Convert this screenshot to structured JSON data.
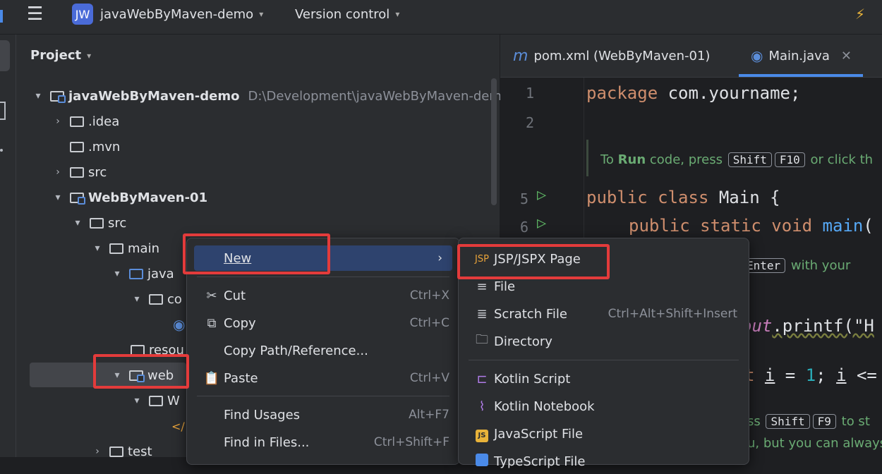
{
  "topbar": {
    "project_badge": "JW",
    "project_name": "javaWebByMaven-demo",
    "vcs": "Version control"
  },
  "project_panel": {
    "title": "Project",
    "tree": [
      {
        "label": "javaWebByMaven-demo",
        "path": "D:\\Development\\javaWebByMaven-demo"
      },
      {
        "label": ".idea"
      },
      {
        "label": ".mvn"
      },
      {
        "label": "src"
      },
      {
        "label": "WebByMaven-01"
      },
      {
        "label": "src"
      },
      {
        "label": "main"
      },
      {
        "label": "java"
      },
      {
        "label": "co"
      },
      {
        "label": "resou"
      },
      {
        "label": "web"
      },
      {
        "label": "W"
      },
      {
        "label": "test"
      }
    ]
  },
  "editor": {
    "tabs": [
      {
        "label": "pom.xml (WebByMaven-01)"
      },
      {
        "label": "Main.java"
      }
    ],
    "line_numbers": [
      "1",
      "2",
      "5",
      "6"
    ],
    "code": {
      "line1_kw": "package",
      "line1_rest": " com.yourname;",
      "line5_kw": "public class",
      "line5_rest": " Main {",
      "line6_kw": "public static void",
      "line6_fn": "main",
      "line6_rest": "(",
      "out_printf": "out",
      "printf": ".printf(\"H",
      "loop_kw": "t",
      "loop_rest": " = ",
      "loop_num": "1",
      "loop_rest2": "; ",
      "loop_i": "i",
      "loop_end": " <=",
      "loop_i1": "i"
    },
    "hints": {
      "run_prefix": "To ",
      "run_bold": "Run",
      "run_mid": " code, press ",
      "run_key1": "Shift",
      "run_key2": "F10",
      "run_suffix": " or click th",
      "enter_key_partial": "",
      "enter_key": "Enter",
      "enter_suffix": " with your",
      "debug_prefix": "ss ",
      "debug_key1": "Shift",
      "debug_key2": "F9",
      "debug_suffix": " to st",
      "last_line": "u, but you can always"
    }
  },
  "context_menu": {
    "items": [
      {
        "label": "New"
      },
      {
        "label": "Cut",
        "shortcut": "Ctrl+X"
      },
      {
        "label": "Copy",
        "shortcut": "Ctrl+C"
      },
      {
        "label": "Copy Path/Reference..."
      },
      {
        "label": "Paste",
        "shortcut": "Ctrl+V"
      },
      {
        "label": "Find Usages",
        "shortcut": "Alt+F7"
      },
      {
        "label": "Find in Files...",
        "shortcut": "Ctrl+Shift+F"
      }
    ]
  },
  "submenu": {
    "items": [
      {
        "label": "JSP/JSPX Page",
        "icon": "JSP"
      },
      {
        "label": "File"
      },
      {
        "label": "Scratch File",
        "shortcut": "Ctrl+Alt+Shift+Insert"
      },
      {
        "label": "Directory"
      },
      {
        "label": "Kotlin Script"
      },
      {
        "label": "Kotlin Notebook"
      },
      {
        "label": "JavaScript File",
        "icon": "JS"
      },
      {
        "label": "TypeScript File"
      }
    ]
  },
  "colors": {
    "highlight_box": "#e33b3b",
    "selection": "#2e436e"
  }
}
